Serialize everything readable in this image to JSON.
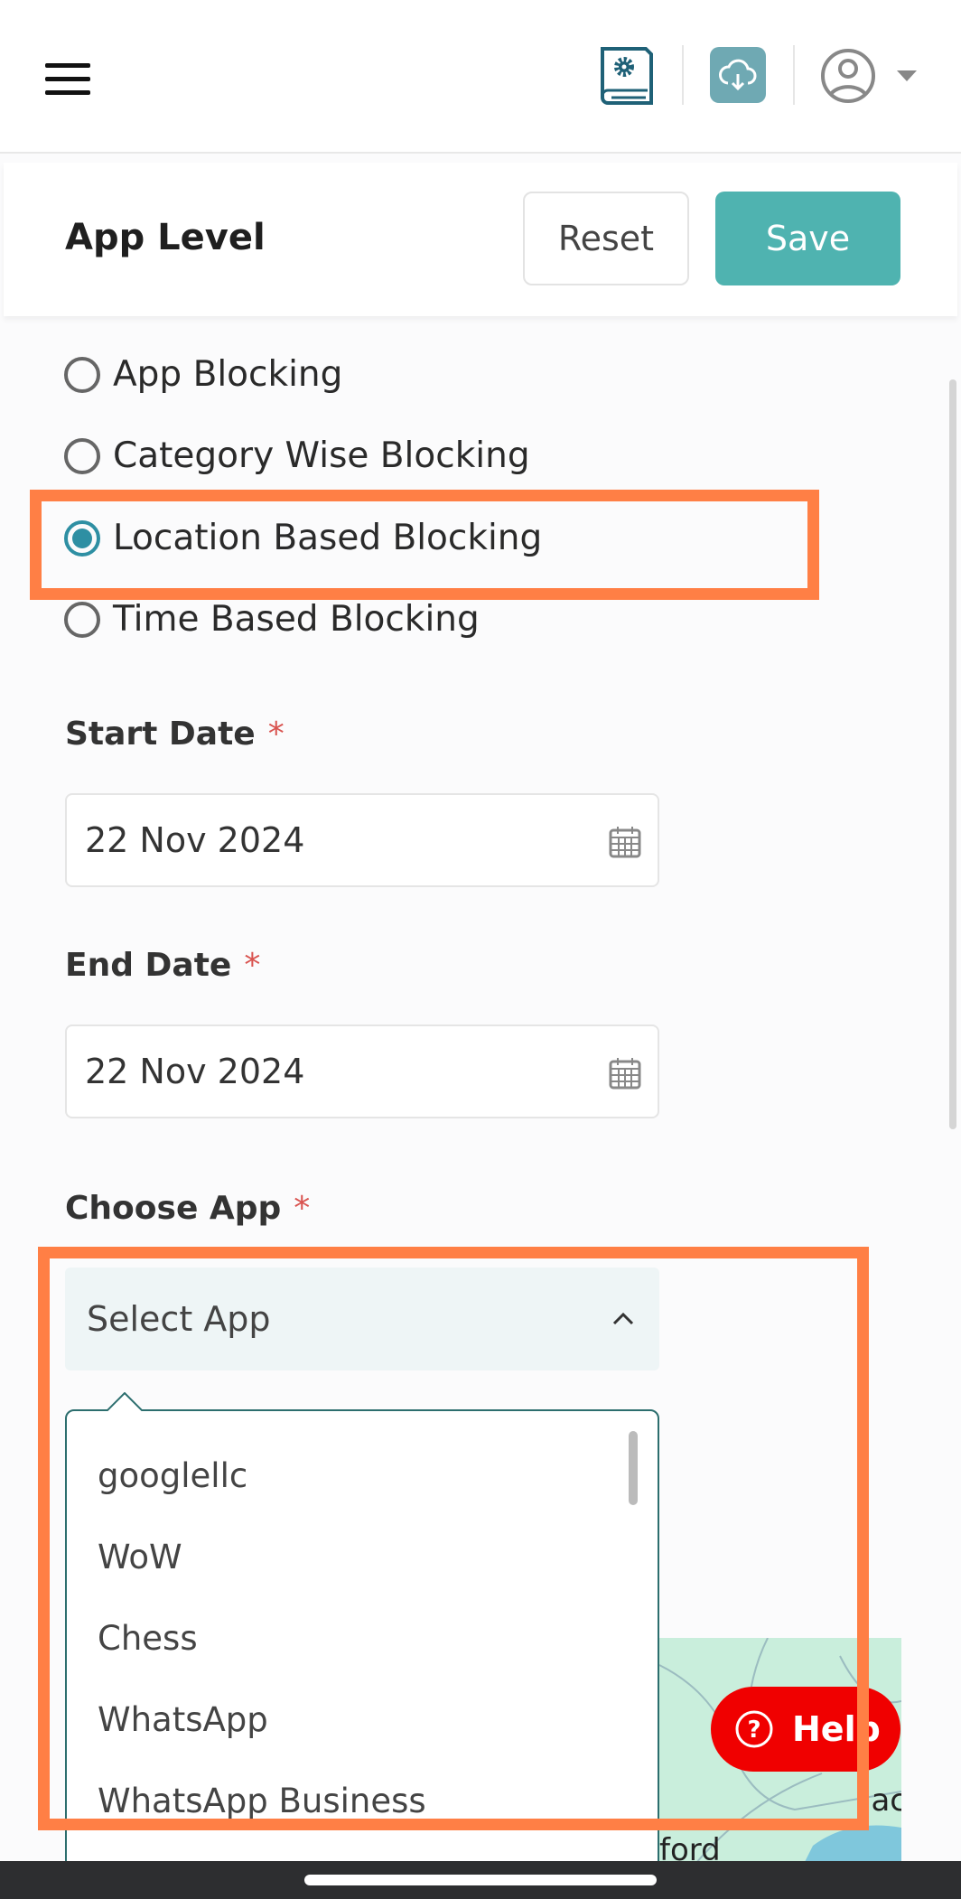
{
  "topbar": {
    "icons": [
      "menu-icon",
      "book-settings-icon",
      "cloud-download-icon",
      "user-avatar-icon",
      "caret-down-icon"
    ]
  },
  "header": {
    "title": "App Level",
    "reset_label": "Reset",
    "save_label": "Save"
  },
  "blocking_options": [
    {
      "label": "App Blocking",
      "selected": false
    },
    {
      "label": "Category Wise Blocking",
      "selected": false
    },
    {
      "label": "Location Based Blocking",
      "selected": true
    },
    {
      "label": "Time Based Blocking",
      "selected": false
    }
  ],
  "form": {
    "start_date": {
      "label": "Start Date",
      "required": "*",
      "value": "22 Nov 2024"
    },
    "end_date": {
      "label": "End Date",
      "required": "*",
      "value": "22 Nov 2024"
    },
    "choose_app": {
      "label": "Choose App",
      "required": "*",
      "placeholder": "Select App",
      "options": [
        "googlellc",
        "WoW",
        "Chess",
        "WhatsApp",
        "WhatsApp Business"
      ]
    }
  },
  "map": {
    "labels": [
      "ford",
      "lac"
    ]
  },
  "help": {
    "label": "Help"
  },
  "colors": {
    "accent": "#4fb3b0",
    "highlight": "#ff7f45",
    "help": "#f00000",
    "radio": "#2e8fa3"
  }
}
